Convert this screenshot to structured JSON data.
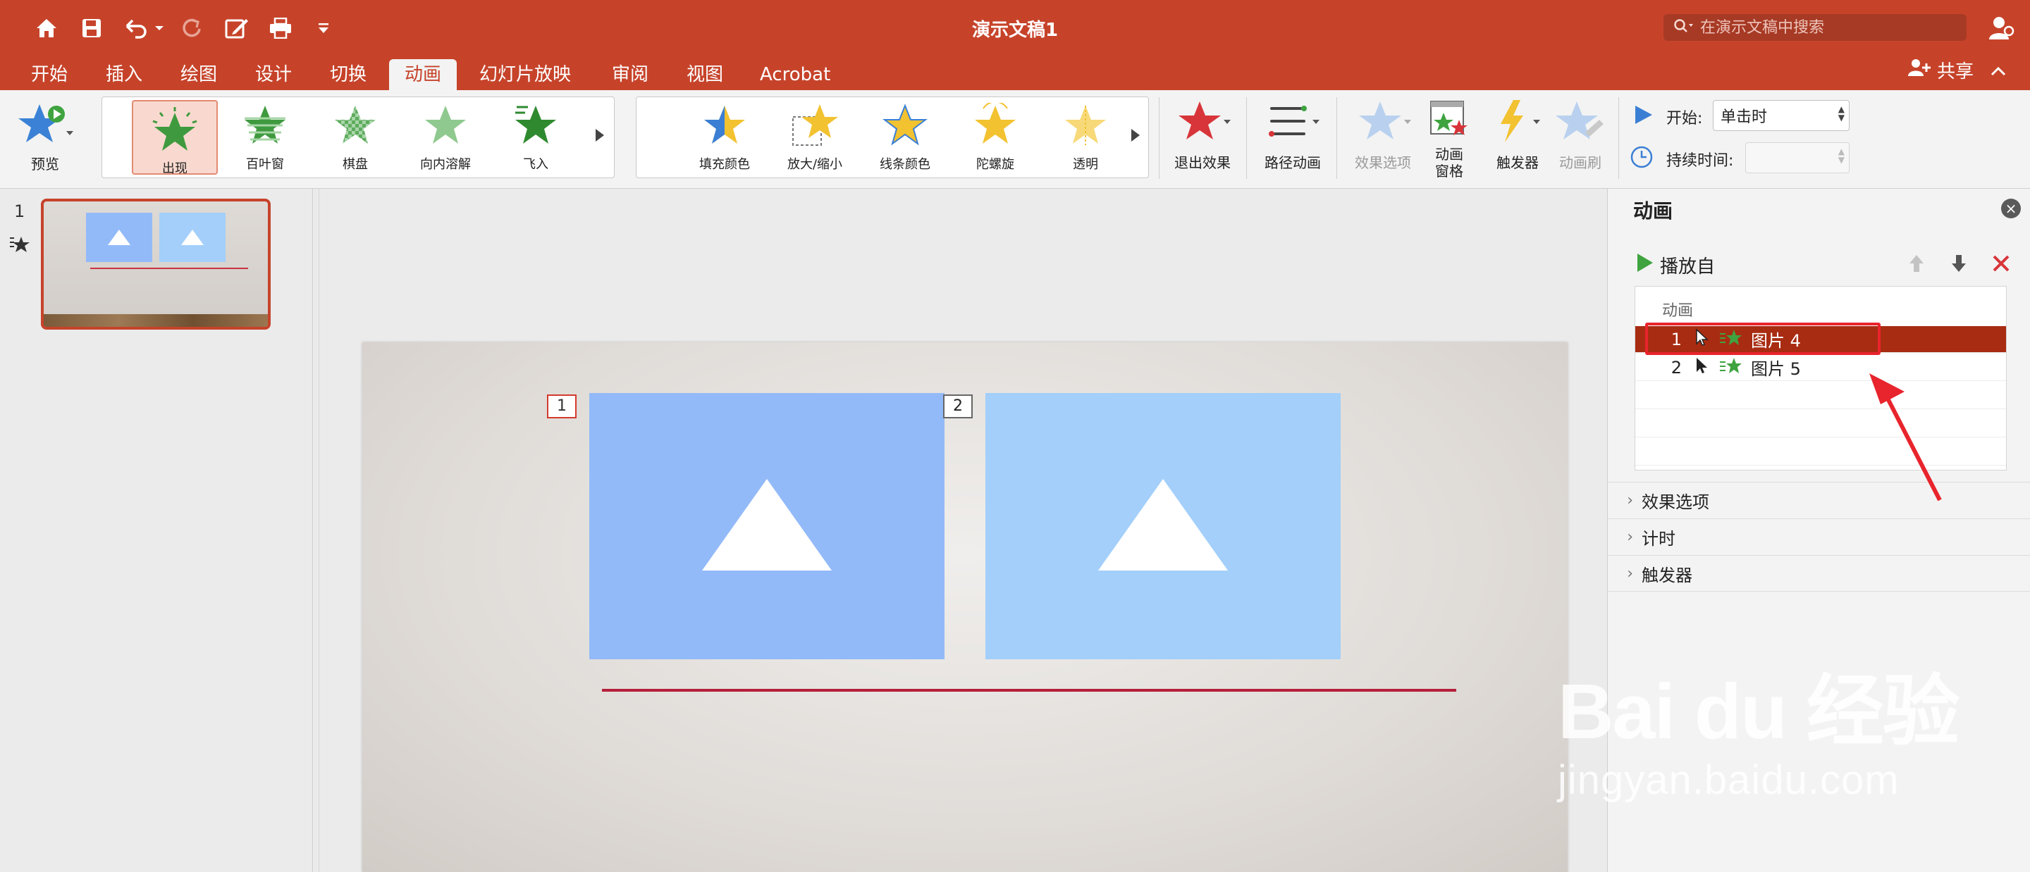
{
  "window": {
    "title": "演示文稿1"
  },
  "search": {
    "placeholder": "在演示文稿中搜索"
  },
  "tabs": [
    {
      "label": "开始"
    },
    {
      "label": "插入"
    },
    {
      "label": "绘图"
    },
    {
      "label": "设计"
    },
    {
      "label": "切换"
    },
    {
      "label": "动画"
    },
    {
      "label": "幻灯片放映"
    },
    {
      "label": "审阅"
    },
    {
      "label": "视图"
    },
    {
      "label": "Acrobat"
    }
  ],
  "share": {
    "label": "共享"
  },
  "ribbon": {
    "preview": "预览",
    "entrance_effects": [
      "出现",
      "百叶窗",
      "棋盘",
      "向内溶解",
      "飞入"
    ],
    "emphasis_effects": [
      "填充颜色",
      "放大/缩小",
      "线条颜色",
      "陀螺旋",
      "透明"
    ],
    "exit_effects": "退出效果",
    "path_animation": "路径动画",
    "effect_options": "效果选项",
    "animation_pane_line1": "动画",
    "animation_pane_line2": "窗格",
    "trigger": "触发器",
    "animation_painter": "动画刷",
    "start_label": "开始:",
    "start_value": "单击时",
    "duration_label": "持续时间:",
    "duration_value": ""
  },
  "slides_panel": {
    "slide_number": "1"
  },
  "slide": {
    "tags": [
      "1",
      "2"
    ]
  },
  "animation_pane": {
    "title": "动画",
    "play_from": "播放自",
    "list_header": "动画",
    "items": [
      {
        "num": "1",
        "name": "图片 4"
      },
      {
        "num": "2",
        "name": "图片 5"
      }
    ],
    "sections": [
      "效果选项",
      "计时",
      "触发器"
    ]
  },
  "watermark": {
    "logo": "Bai du 经验",
    "url": "jingyan.baidu.com"
  },
  "colors": {
    "accent": "#c6432a",
    "selected_row": "#a82c12",
    "picture_left": "#93baf8",
    "picture_right": "#a3cffa",
    "highlight": "#e8242c"
  }
}
